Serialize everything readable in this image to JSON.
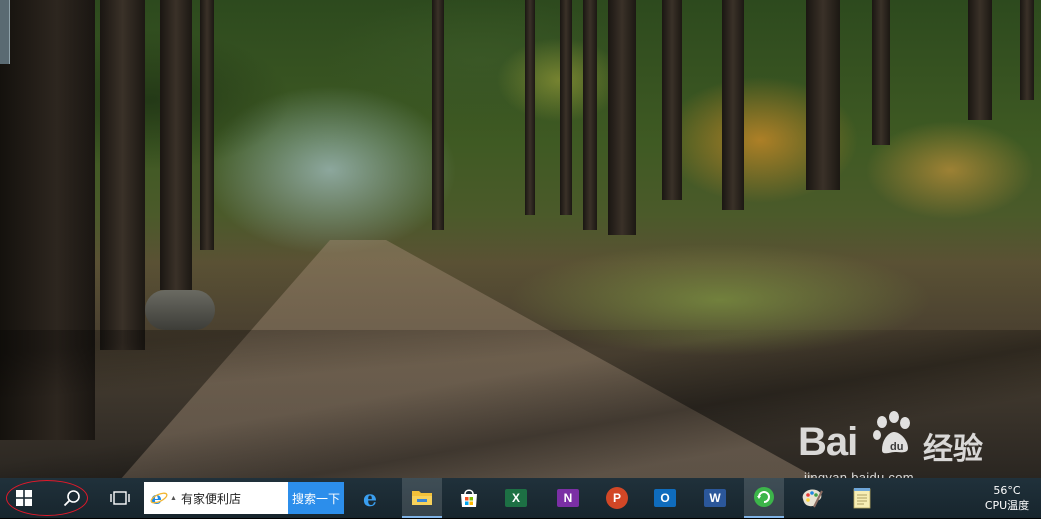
{
  "taskbar": {
    "search_text": "有家便利店",
    "search_button_label": "搜索一下",
    "apps": [
      {
        "name": "edge",
        "icon": "edge-icon"
      },
      {
        "name": "file-explorer",
        "icon": "folder-icon"
      },
      {
        "name": "store",
        "icon": "store-icon"
      },
      {
        "name": "excel",
        "icon": "excel-icon",
        "letter": "X",
        "color": "#1d7044"
      },
      {
        "name": "onenote",
        "icon": "onenote-icon",
        "letter": "N",
        "color": "#7b2fa5"
      },
      {
        "name": "powerpoint",
        "icon": "powerpoint-icon",
        "letter": "P",
        "color": "#d24726"
      },
      {
        "name": "outlook",
        "icon": "outlook-icon",
        "letter": "O",
        "color": "#0f6cbd"
      },
      {
        "name": "word",
        "icon": "word-icon",
        "letter": "W",
        "color": "#2b579a"
      },
      {
        "name": "green-app",
        "icon": "refresh-green-icon"
      },
      {
        "name": "paint",
        "icon": "paint-palette-icon"
      },
      {
        "name": "notepad",
        "icon": "notepad-icon"
      }
    ],
    "tray": {
      "temperature": "56°C",
      "cpu_label": "CPU温度"
    }
  },
  "watermark": {
    "logo_text": "Bai",
    "logo_text_2": "du",
    "brand_cn": "经验",
    "url": "jingyan.baidu.com"
  },
  "colors": {
    "taskbar_bg": "#1b2a33",
    "search_button": "#2c8eeb",
    "highlight_circle": "#e0192a"
  }
}
